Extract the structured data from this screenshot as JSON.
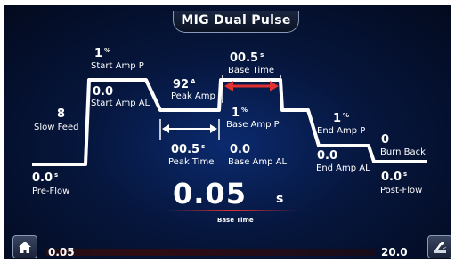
{
  "title": "MIG Dual Pulse",
  "params": {
    "pre_flow": {
      "value": "0.0",
      "unit": "s",
      "label": "Pre-Flow"
    },
    "slow_feed": {
      "value": "8",
      "label": "Slow Feed"
    },
    "start_amp_p": {
      "value": "1",
      "unit": "%",
      "label": "Start Amp P"
    },
    "start_amp_al": {
      "value": "0.0",
      "label": "Start Amp AL"
    },
    "peak_amp": {
      "value": "92",
      "unit": "A",
      "label": "Peak Amp"
    },
    "peak_time": {
      "value": "00.5",
      "unit": "s",
      "label": "Peak Time"
    },
    "base_time": {
      "value": "00.5",
      "unit": "s",
      "label": "Base Time"
    },
    "base_amp_p": {
      "value": "1",
      "unit": "%",
      "label": "Base Amp P"
    },
    "base_amp_al": {
      "value": "0.0",
      "label": "Base Amp AL"
    },
    "end_amp_p": {
      "value": "1",
      "unit": "%",
      "label": "End Amp P"
    },
    "end_amp_al": {
      "value": "0.0",
      "label": "End Amp AL"
    },
    "burn_back": {
      "value": "0",
      "label": "Burn Back"
    },
    "post_flow": {
      "value": "0.0",
      "unit": "s",
      "label": "Post-Flow"
    }
  },
  "selected": {
    "value": "0.05",
    "unit": "s",
    "label": "Base Time"
  },
  "range": {
    "min": "0.05",
    "max": "20.0"
  },
  "icons": {
    "home": "home-icon",
    "weld": "welding-torch-icon"
  },
  "colors": {
    "accent": "#e23030",
    "line": "#ffffff",
    "background": "#06163d"
  }
}
